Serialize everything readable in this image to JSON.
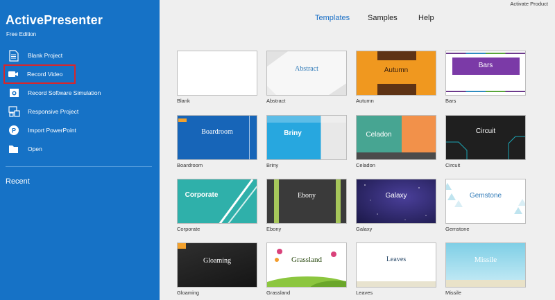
{
  "sidebar": {
    "app_title": "ActivePresenter",
    "edition": "Free Edition",
    "items": [
      {
        "label": "Blank Project",
        "icon": "document-icon"
      },
      {
        "label": "Record Video",
        "icon": "video-camera-icon"
      },
      {
        "label": "Record Software Simulation",
        "icon": "camera-icon"
      },
      {
        "label": "Responsive Project",
        "icon": "responsive-icon"
      },
      {
        "label": "Import PowerPoint",
        "icon": "powerpoint-icon"
      },
      {
        "label": "Open",
        "icon": "folder-open-icon"
      }
    ],
    "recent_label": "Recent"
  },
  "topbar": {
    "activate": "Activate Product",
    "tabs": [
      "Templates",
      "Samples",
      "Help"
    ],
    "active_tab": "Templates"
  },
  "templates": [
    {
      "name": "Blank",
      "title": ""
    },
    {
      "name": "Abstract",
      "title": "Abstract"
    },
    {
      "name": "Autumn",
      "title": "Autumn"
    },
    {
      "name": "Bars",
      "title": "Bars"
    },
    {
      "name": "Boardroom",
      "title": "Boardroom"
    },
    {
      "name": "Briny",
      "title": "Briny"
    },
    {
      "name": "Celadon",
      "title": "Celadon"
    },
    {
      "name": "Circuit",
      "title": "Circuit"
    },
    {
      "name": "Corporate",
      "title": "Corporate"
    },
    {
      "name": "Ebony",
      "title": "Ebony"
    },
    {
      "name": "Galaxy",
      "title": "Galaxy"
    },
    {
      "name": "Gemstone",
      "title": "Gemstone"
    },
    {
      "name": "Gloaming",
      "title": "Gloaming"
    },
    {
      "name": "Grassland",
      "title": "Grassland"
    },
    {
      "name": "Leaves",
      "title": "Leaves"
    },
    {
      "name": "Missile",
      "title": "Missile"
    }
  ],
  "colors": {
    "sidebar_bg": "#1672c6",
    "accent": "#1a6fc6",
    "highlight_border": "#d9262b",
    "main_bg": "#efefef"
  }
}
